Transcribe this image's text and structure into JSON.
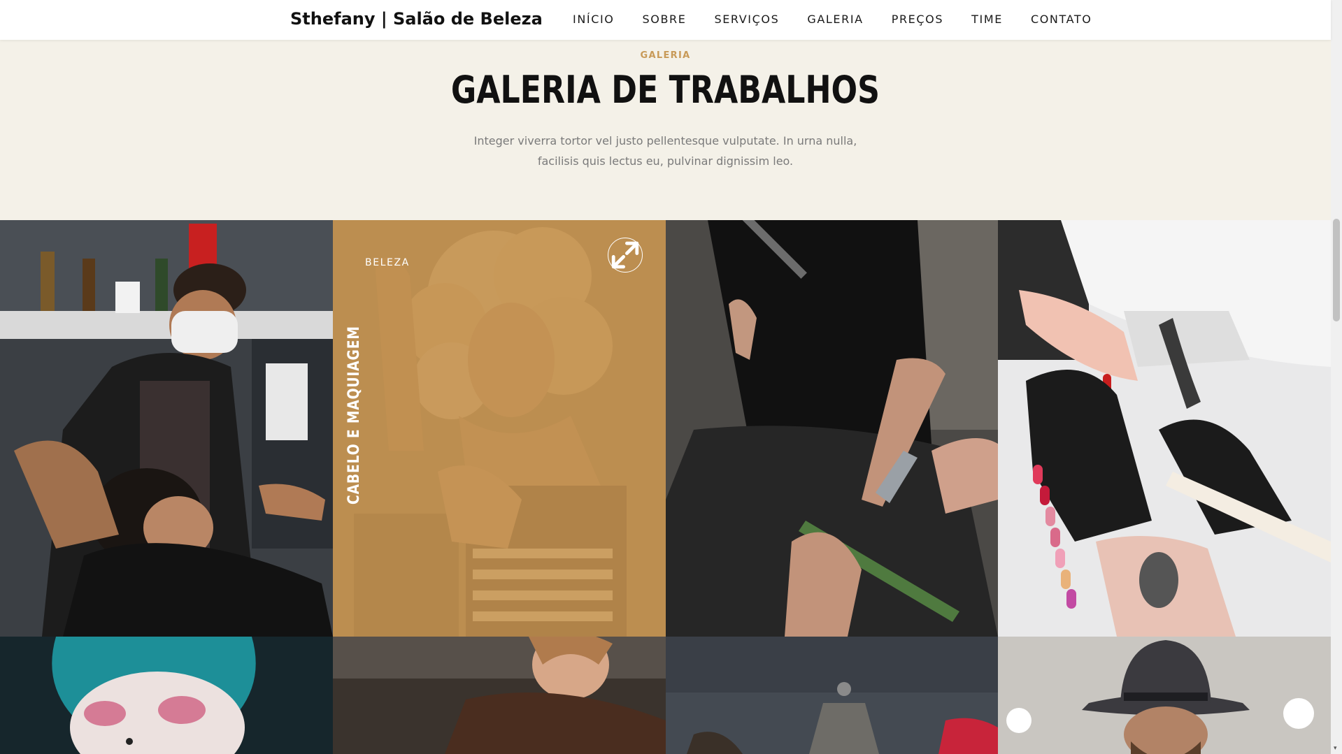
{
  "nav": {
    "brand": "Sthefany | Salão de Beleza",
    "items": [
      "INÍCIO",
      "SOBRE",
      "SERVIÇOS",
      "GALERIA",
      "PREÇOS",
      "TIME",
      "CONTATO"
    ]
  },
  "section": {
    "eyebrow": "GALERIA",
    "title": "GALERIA DE TRABALHOS",
    "description": "Integer viverra tortor vel justo pellentesque vulputate. In urna nulla, facilisis quis lectus eu, pulvinar dignissim leo."
  },
  "gallery": {
    "hovered": {
      "category": "BELEZA",
      "title": "CABELO E MAQUIAGEM",
      "icon": "expand-icon"
    }
  },
  "colors": {
    "accent": "#c89a58",
    "overlay": "#c49452",
    "background": "#f4f1e8"
  }
}
